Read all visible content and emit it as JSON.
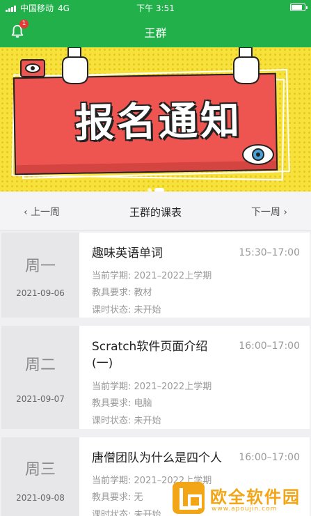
{
  "status_bar": {
    "carrier": "中国移动",
    "network": "4G",
    "time": "下午 3:51"
  },
  "navbar": {
    "title": "王群",
    "notification_count": "1"
  },
  "banner": {
    "text": "报名通知",
    "page_count": 2,
    "active_page": 1
  },
  "week_nav": {
    "prev_label": "上一周",
    "title": "王群的课表",
    "next_label": "下一周"
  },
  "courses": [
    {
      "day": "周一",
      "date": "2021-09-06",
      "title": "趣味英语单词",
      "time": "15:30–17:00",
      "semester_label": "当前学期:",
      "semester": "2021–2022上学期",
      "equipment_label": "教具要求:",
      "equipment": "教材",
      "status_label": "课时状态:",
      "status": "未开始"
    },
    {
      "day": "周二",
      "date": "2021-09-07",
      "title": "Scratch软件页面介绍(一)",
      "time": "16:00–17:00",
      "semester_label": "当前学期:",
      "semester": "2021–2022上学期",
      "equipment_label": "教具要求:",
      "equipment": "电脑",
      "status_label": "课时状态:",
      "status": "未开始"
    },
    {
      "day": "周三",
      "date": "2021-09-08",
      "title": "唐僧团队为什么是四个人",
      "time": "16:00–17:00",
      "semester_label": "当前学期:",
      "semester": "2021–2022上学期",
      "equipment_label": "教具要求:",
      "equipment": "无",
      "status_label": "课时状态:",
      "status": "未开始"
    }
  ],
  "watermark": {
    "text": "欧全软件园",
    "url": "www.apoujin.com"
  },
  "colors": {
    "header_green": "#22b04b",
    "banner_yellow": "#f7e23c",
    "banner_red": "#ef5550",
    "badge_red": "#e53935"
  }
}
